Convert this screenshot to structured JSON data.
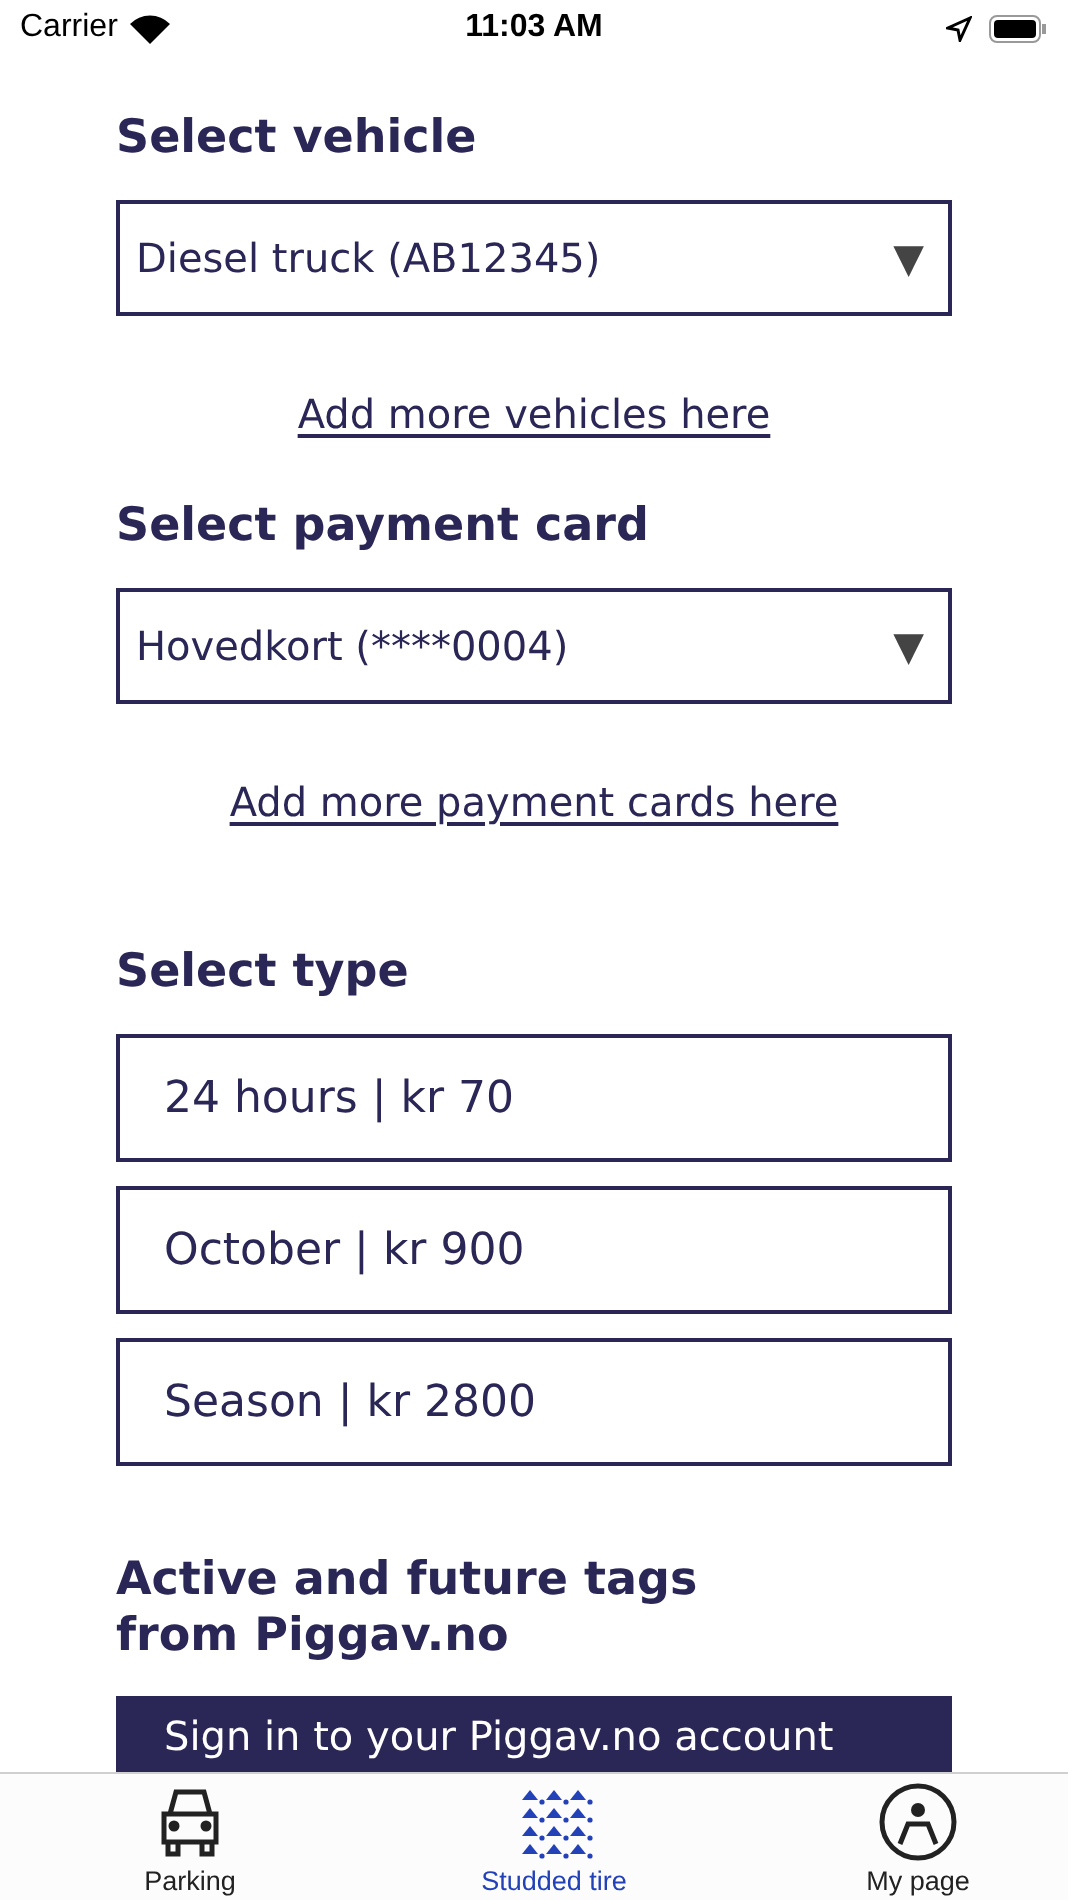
{
  "status_bar": {
    "carrier": "Carrier",
    "time": "11:03 AM"
  },
  "vehicle": {
    "label": "Select vehicle",
    "value": "Diesel truck (AB12345)",
    "arrow": "▼",
    "link": "Add more vehicles here"
  },
  "payment": {
    "label": "Select payment card",
    "value": "Hovedkort (****0004)",
    "arrow": "▼",
    "link": "Add more payment cards here"
  },
  "type": {
    "label": "Select type",
    "options": [
      {
        "label": "24 hours | kr 70"
      },
      {
        "label": "October | kr 900"
      },
      {
        "label": "Season | kr 2800"
      }
    ]
  },
  "tags": {
    "title": "Active and future tags from Piggav.no",
    "button": "Sign in to your Piggav.no account"
  },
  "tab_bar": [
    {
      "label": "Parking",
      "kind": "car",
      "selected": false
    },
    {
      "label": "Studded tire",
      "kind": "studs",
      "selected": true
    },
    {
      "label": "My page",
      "kind": "person",
      "selected": false
    }
  ]
}
